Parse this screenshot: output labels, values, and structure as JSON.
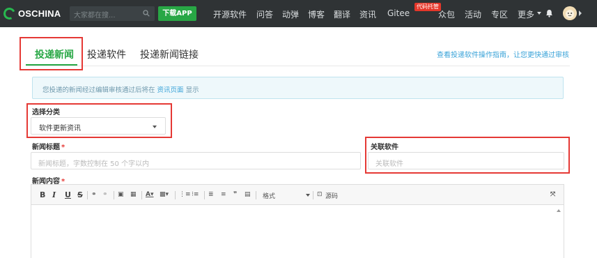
{
  "brand": {
    "name": "OSCHINA",
    "accent": "#28a745",
    "topbar_bg": "#2f3335"
  },
  "search": {
    "placeholder": "大家都在搜..."
  },
  "topnav": {
    "app_label": "下载APP",
    "items": [
      "开源软件",
      "问答",
      "动弹",
      "博客",
      "翻译",
      "资讯",
      "Gitee",
      "众包",
      "活动",
      "专区",
      "更多"
    ],
    "gitee_badge": "代码托管"
  },
  "tabs": [
    {
      "label": "投递新闻",
      "active": true
    },
    {
      "label": "投递软件",
      "active": false
    },
    {
      "label": "投递新闻链接",
      "active": false
    }
  ],
  "guide_link": "查看投递软件操作指南，让您更快通过审核",
  "notice": {
    "text": "您投递的新闻经过编辑审核通过后将在",
    "link": "资讯页面",
    "suffix": "显示"
  },
  "category": {
    "label": "选择分类",
    "value": "软件更新资讯"
  },
  "title_field": {
    "label": "新闻标题",
    "required": "*",
    "placeholder": "新闻标题，字数控制在 50 个字以内"
  },
  "related": {
    "label": "关联软件",
    "placeholder": "关联软件"
  },
  "content": {
    "label": "新闻内容",
    "required": "*"
  },
  "editor_toolbar": {
    "format_label": "格式",
    "source_label": "源码"
  },
  "icons": [
    "search-icon",
    "bell-icon",
    "caret-down-icon",
    "fullscreen-icon"
  ]
}
